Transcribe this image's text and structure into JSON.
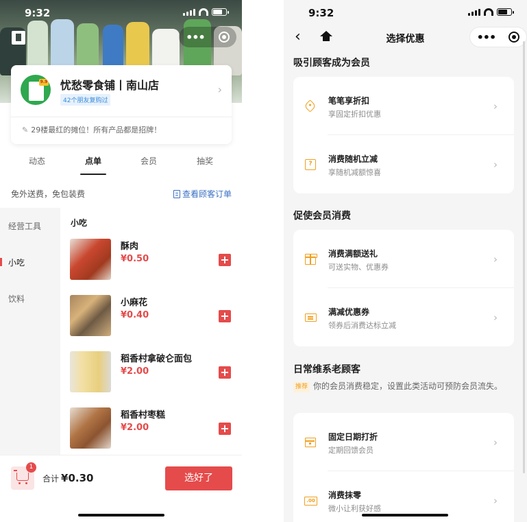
{
  "left": {
    "status": {
      "time": "9:32"
    },
    "store": {
      "name": "忧愁零食铺丨南山店",
      "friends_tag": "42个朋友复购过",
      "slogan": "29楼最红的摊位！所有产品都是招牌！",
      "logo_badge": "9.9"
    },
    "tabs": [
      "动态",
      "点单",
      "会员",
      "抽奖"
    ],
    "notice": "免外送费，免包装费",
    "orders_link": "查看顾客订单",
    "categories": [
      "经营工具",
      "小吃",
      "饮料"
    ],
    "section_title": "小吃",
    "products": [
      {
        "name": "酥肉",
        "price": "¥0.50"
      },
      {
        "name": "小麻花",
        "price": "¥0.40"
      },
      {
        "name": "稻香村拿破仑面包",
        "price": "¥2.00"
      },
      {
        "name": "稻香村枣糕",
        "price": "¥2.00"
      }
    ],
    "cart": {
      "badge": "1",
      "total_label": "合计",
      "total_value": "¥0.30",
      "checkout_label": "选好了"
    }
  },
  "right": {
    "status": {
      "time": "9:32"
    },
    "title": "选择优惠",
    "groups": [
      {
        "title": "吸引顾客成为会员",
        "items": [
          {
            "title": "笔笔享折扣",
            "subtitle": "享固定折扣优惠",
            "icon": "tag-icon"
          },
          {
            "title": "消费随机立减",
            "subtitle": "享随机减额惊喜",
            "icon": "question-box-icon"
          }
        ]
      },
      {
        "title": "促使会员消费",
        "items": [
          {
            "title": "消费满额送礼",
            "subtitle": "可送实物、优惠券",
            "icon": "gift-icon"
          },
          {
            "title": "满减优惠券",
            "subtitle": "领券后消费达标立减",
            "icon": "coupon-icon"
          }
        ]
      },
      {
        "title": "日常维系老顾客",
        "recommend_tag": "推荐",
        "recommend_text": "你的会员消费稳定，设置此类活动可预防会员流失。",
        "items": [
          {
            "title": "固定日期打折",
            "subtitle": "定期回馈会员",
            "icon": "calendar-icon"
          },
          {
            "title": "消费抹零",
            "subtitle": "微小让利获好感",
            "icon": "zero-box-icon"
          }
        ]
      }
    ],
    "icon_glyphs": {
      "question_box": "?",
      "zero_box": ".00"
    }
  },
  "colors": {
    "accent_red": "#e54b4b",
    "accent_orange": "#f0a020",
    "link_blue": "#3a6fc4"
  }
}
